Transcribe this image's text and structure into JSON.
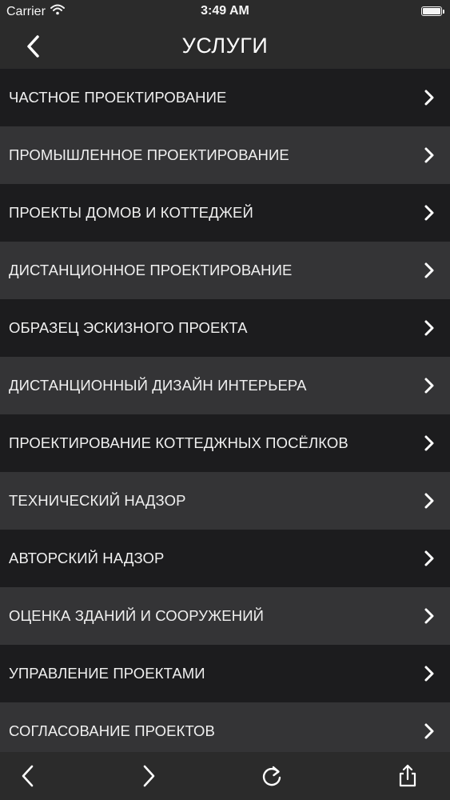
{
  "status_bar": {
    "carrier": "Carrier",
    "time": "3:49 AM"
  },
  "nav": {
    "title": "УСЛУГИ"
  },
  "services": [
    {
      "label": "ЧАСТНОЕ ПРОЕКТИРОВАНИЕ"
    },
    {
      "label": "ПРОМЫШЛЕННОЕ ПРОЕКТИРОВАНИЕ"
    },
    {
      "label": "ПРОЕКТЫ ДОМОВ И КОТТЕДЖЕЙ"
    },
    {
      "label": "ДИСТАНЦИОННОЕ ПРОЕКТИРОВАНИЕ"
    },
    {
      "label": "ОБРАЗЕЦ ЭСКИЗНОГО ПРОЕКТА"
    },
    {
      "label": "ДИСТАНЦИОННЫЙ ДИЗАЙН ИНТЕРЬЕРА"
    },
    {
      "label": "ПРОЕКТИРОВАНИЕ КОТТЕДЖНЫХ ПОСЁЛКОВ"
    },
    {
      "label": "ТЕХНИЧЕСКИЙ НАДЗОР"
    },
    {
      "label": "АВТОРСКИЙ НАДЗОР"
    },
    {
      "label": "ОЦЕНКА ЗДАНИЙ И СООРУЖЕНИЙ"
    },
    {
      "label": "УПРАВЛЕНИЕ ПРОЕКТАМИ"
    },
    {
      "label": "СОГЛАСОВАНИЕ ПРОЕКТОВ"
    }
  ],
  "icons": {
    "wifi": "wifi-icon",
    "battery": "battery-icon",
    "back": "chevron-left-icon",
    "row_chevron": "chevron-right-icon",
    "toolbar_back": "arrow-back-icon",
    "toolbar_forward": "arrow-forward-icon",
    "toolbar_reload": "reload-icon",
    "toolbar_share": "share-icon"
  },
  "colors": {
    "bar_background": "#2b2b2b",
    "row_dark": "#1c1c1e",
    "row_light": "#343436",
    "text": "#f0f0f0"
  }
}
